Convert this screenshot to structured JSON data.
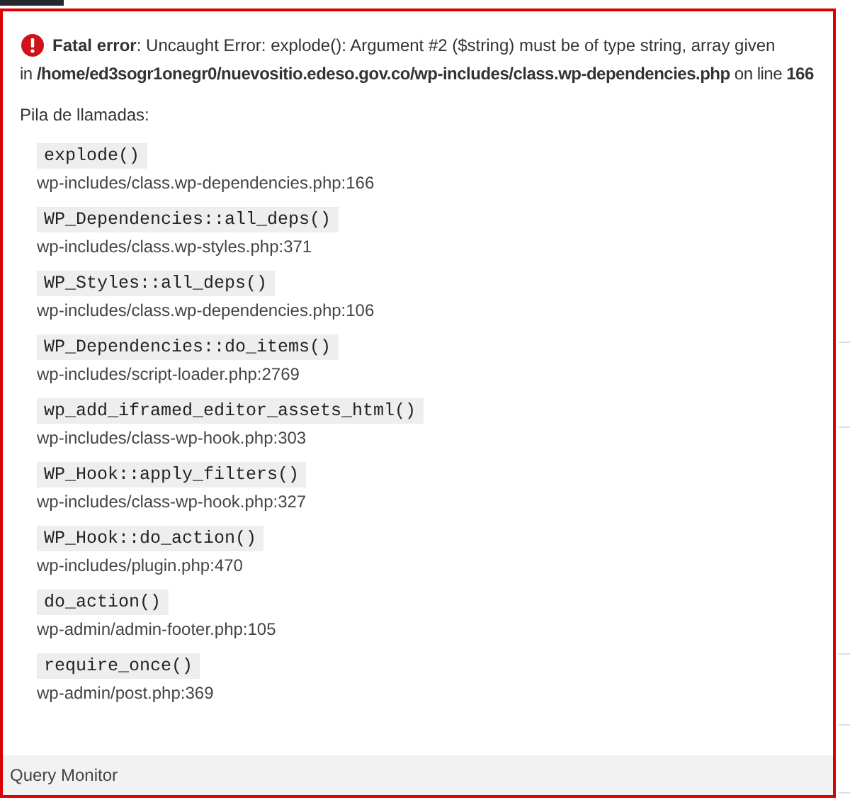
{
  "error": {
    "message": "**Fatal error**: Uncaught Error: explode(): Argument #2 ($string) must be of type string, array given",
    "location": "in **/home/ed3sogr1onegr0/nuevositio.edeso.gov.co/wp-includes/class.wp-dependencies.php** on line **166**"
  },
  "stack_heading": "Pila de llamadas:",
  "stack": [
    {
      "function": "explode()",
      "file": "wp-includes/class.wp-dependencies.php:166"
    },
    {
      "function": "WP_Dependencies::all_deps()",
      "file": "wp-includes/class.wp-styles.php:371"
    },
    {
      "function": "WP_Styles::all_deps()",
      "file": "wp-includes/class.wp-dependencies.php:106"
    },
    {
      "function": "WP_Dependencies::do_items()",
      "file": "wp-includes/script-loader.php:2769"
    },
    {
      "function": "wp_add_iframed_editor_assets_html()",
      "file": "wp-includes/class-wp-hook.php:303"
    },
    {
      "function": "WP_Hook::apply_filters()",
      "file": "wp-includes/class-wp-hook.php:327"
    },
    {
      "function": "WP_Hook::do_action()",
      "file": "wp-includes/plugin.php:470"
    },
    {
      "function": "do_action()",
      "file": "wp-admin/admin-footer.php:105"
    },
    {
      "function": "require_once()",
      "file": "wp-admin/post.php:369"
    }
  ],
  "footer": "Query Monitor"
}
